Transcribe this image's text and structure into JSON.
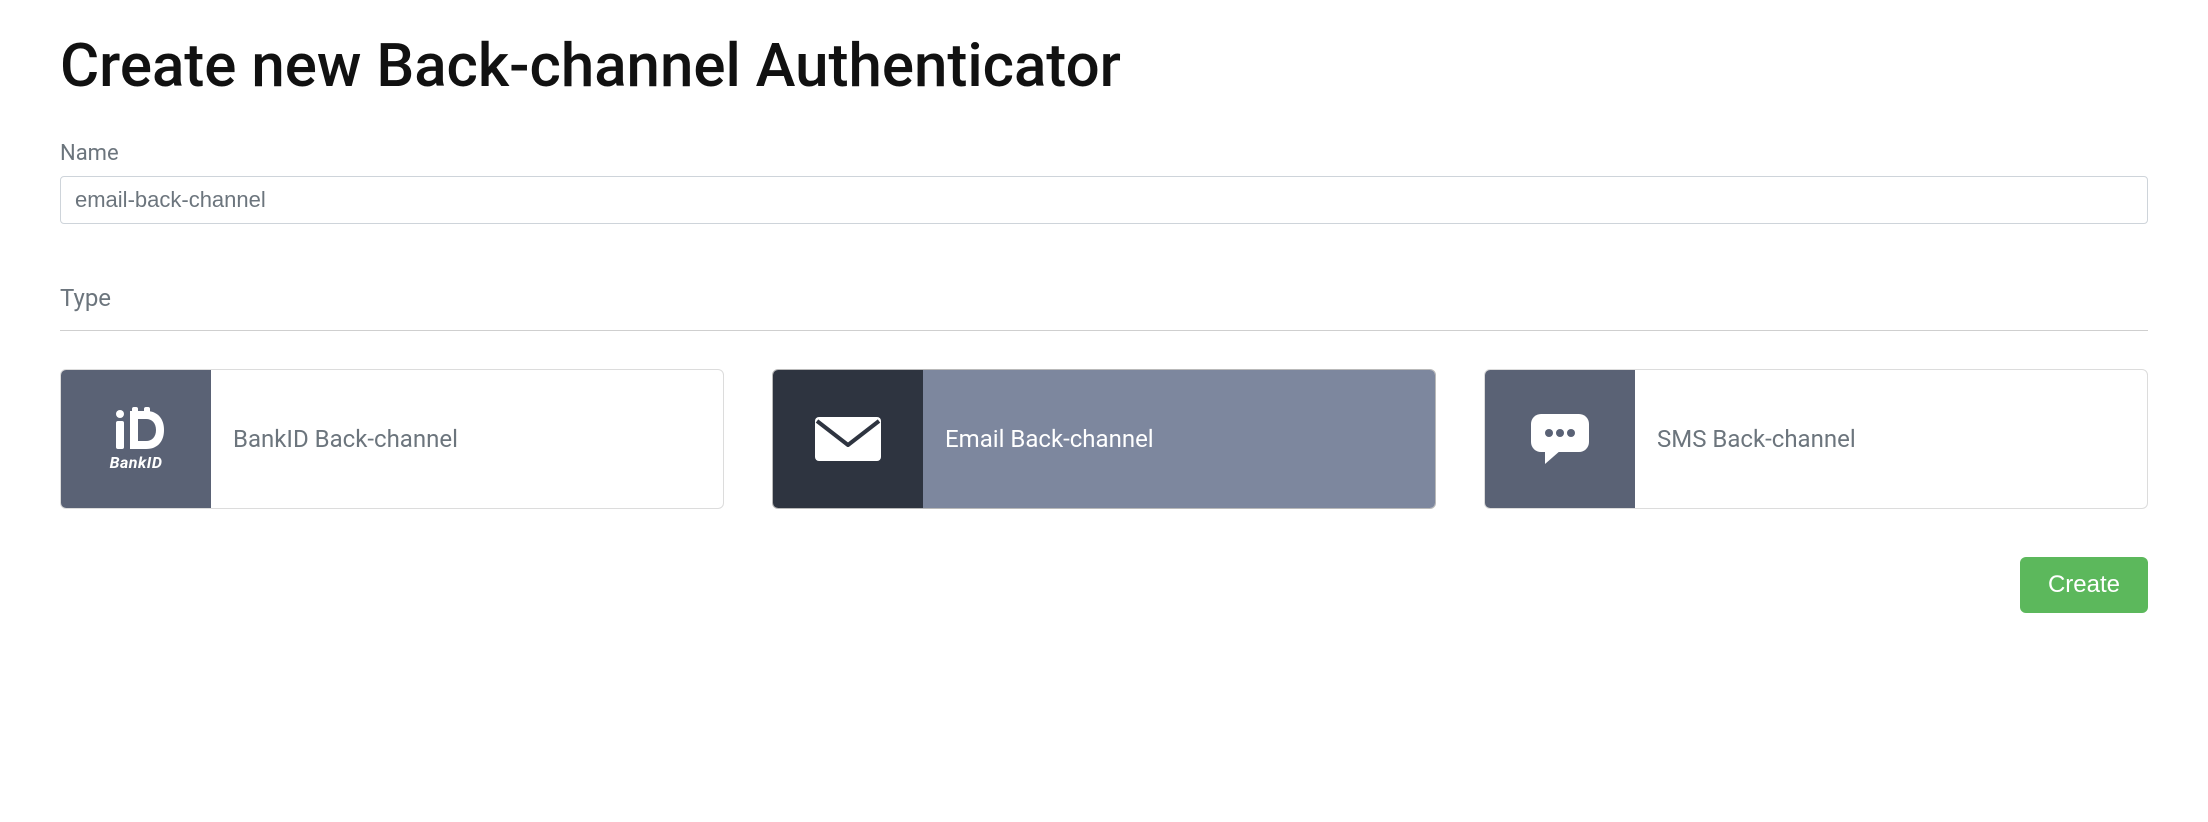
{
  "page": {
    "title": "Create new Back-channel Authenticator"
  },
  "form": {
    "name_label": "Name",
    "name_value": "email-back-channel"
  },
  "type": {
    "label": "Type",
    "options": [
      {
        "label": "BankID Back-channel",
        "icon": "bankid",
        "selected": false,
        "icon_text": "BankID"
      },
      {
        "label": "Email Back-channel",
        "icon": "envelope",
        "selected": true
      },
      {
        "label": "SMS Back-channel",
        "icon": "chat",
        "selected": false
      }
    ]
  },
  "actions": {
    "create_label": "Create"
  }
}
